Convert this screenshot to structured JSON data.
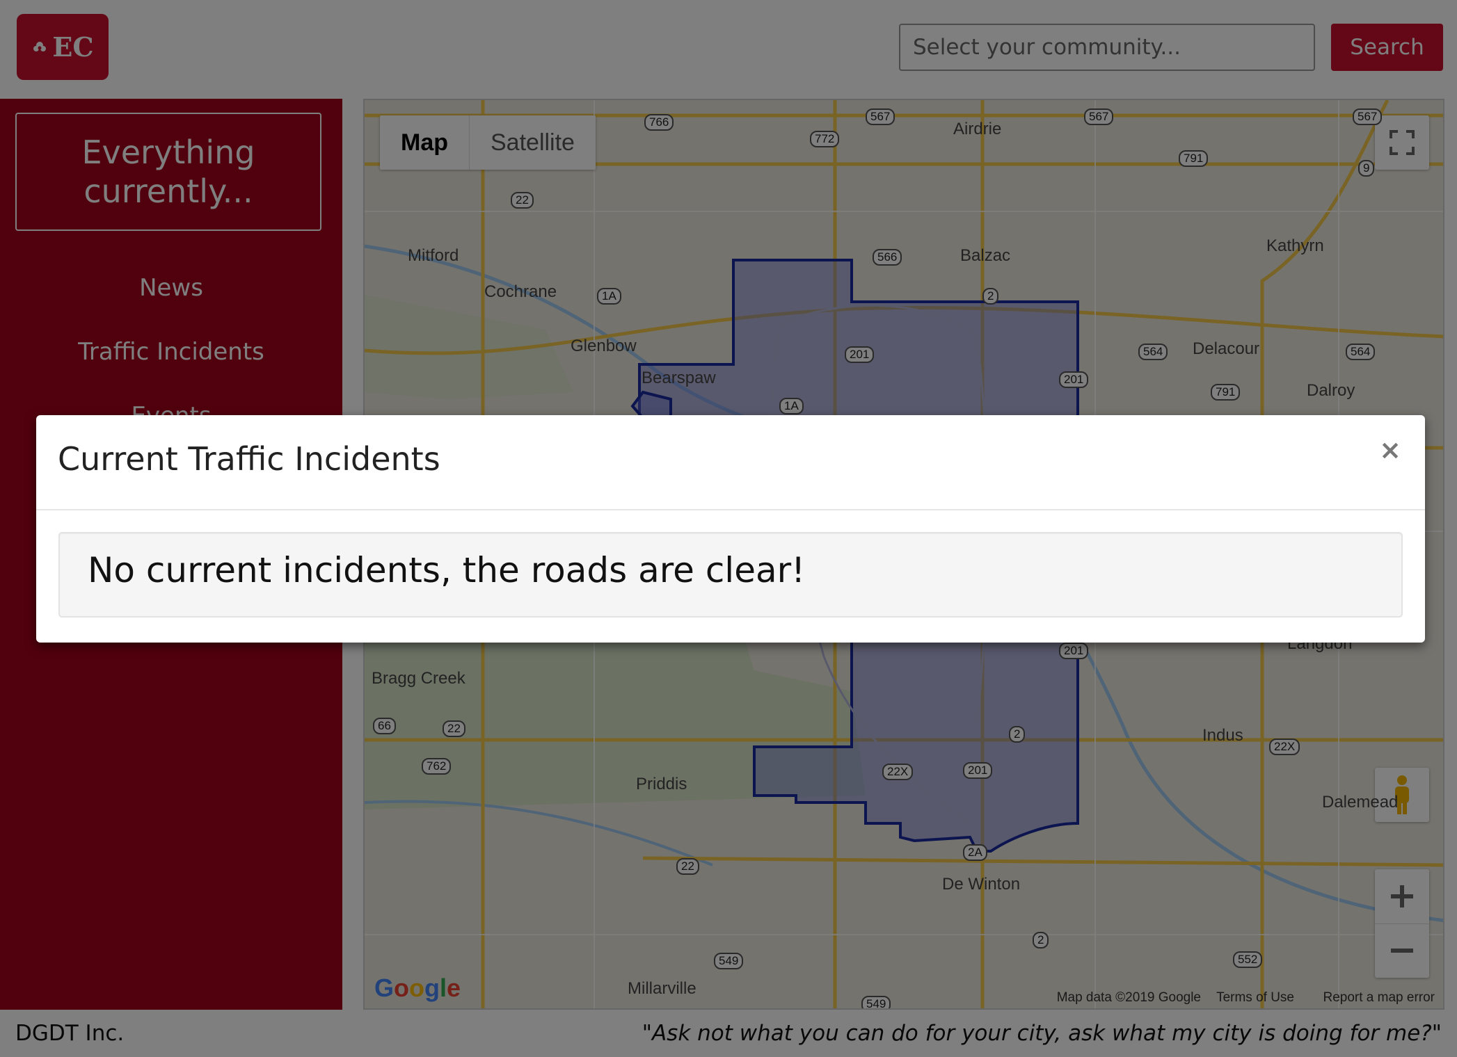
{
  "header": {
    "logo_text": "EC",
    "search_placeholder": "Select your community...",
    "search_button": "Search"
  },
  "sidebar": {
    "title": "Everything currently...",
    "items": [
      {
        "label": "News"
      },
      {
        "label": "Traffic Incidents"
      },
      {
        "label": "Events"
      }
    ]
  },
  "map": {
    "type_buttons": [
      "Map",
      "Satellite"
    ],
    "places": [
      "Airdrie",
      "Mitford",
      "Cochrane",
      "Glenbow",
      "Bearspaw",
      "Balzac",
      "Kathyrn",
      "Delacour",
      "Dalroy",
      "Bragg Creek",
      "Priddis",
      "Indus",
      "Dalemead",
      "De Winton",
      "Millarville",
      "Langdon"
    ],
    "highway_shields": [
      "766",
      "772",
      "567",
      "567",
      "567",
      "791",
      "9",
      "22",
      "1A",
      "566",
      "2",
      "201",
      "201",
      "1A",
      "564",
      "564",
      "791",
      "201",
      "66",
      "22",
      "762",
      "22X",
      "2",
      "22X",
      "201",
      "2A",
      "22",
      "2",
      "549",
      "552",
      "549"
    ],
    "attribution": {
      "map_data": "Map data ©2019 Google",
      "terms": "Terms of Use",
      "report": "Report a map error"
    },
    "google_logo": "Google",
    "colors": {
      "boundary": "#1a2aa0",
      "boundary_fill": "#6b73d6",
      "road": "#f2c94c"
    }
  },
  "footer": {
    "left": "DGDT Inc.",
    "right": "\"Ask not what you can do for your city, ask what my city is doing for me?\""
  },
  "modal": {
    "title": "Current Traffic Incidents",
    "close": "×",
    "message": "No current incidents, the roads are clear!"
  },
  "colors": {
    "brand": "#c8102e",
    "sidebar": "#a3001b"
  }
}
